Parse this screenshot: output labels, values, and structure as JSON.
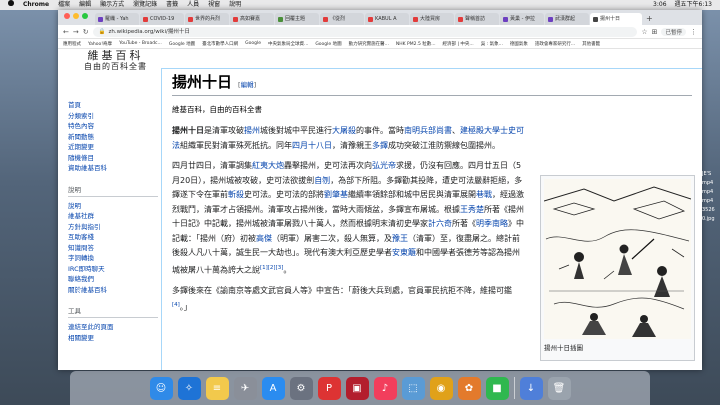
{
  "menubar": {
    "left": [
      "",
      "Chrome",
      "檔案",
      "編輯",
      "顯示方式",
      "瀏覽記錄",
      "書籤",
      "人員",
      "視窗",
      "說明"
    ],
    "right": [
      "3:06",
      "週五下午6:13"
    ]
  },
  "browser": {
    "tabs": [
      {
        "label": "羅織 - Yah",
        "color": "#6d3fc0"
      },
      {
        "label": "COVID-19",
        "color": "#e23b3b"
      },
      {
        "label": "世界的兵烈",
        "color": "#e23b3b"
      },
      {
        "label": "高如賽嘉",
        "color": "#e23b3b"
      },
      {
        "label": "回覆主題",
        "color": "#4a8f3a"
      },
      {
        "label": "《從烈",
        "color": "#e23b3b"
      },
      {
        "label": "KABUL A",
        "color": "#e23b3b"
      },
      {
        "label": "大陸買房",
        "color": "#e23b3b"
      },
      {
        "label": "聲稱首訪",
        "color": "#e23b3b"
      },
      {
        "label": "黃巢 - 伊拉",
        "color": "#6d3fc0"
      },
      {
        "label": "武漢群起",
        "color": "#6d3fc0"
      },
      {
        "label": "揚州十日",
        "color": "#444444",
        "active": true
      }
    ],
    "new_tab": "+",
    "url": "zh.wikipedia.org/wiki/揚州十日",
    "paused_label": "已暫停",
    "bookmarks": [
      "應用程式",
      "Yahoo!奇摩",
      "YouTube - Broadc...",
      "Google 地圖",
      "臺北市數學人口網",
      "Google",
      "中央氣象局全球資...",
      "Google 地圖",
      "動力研究實施在醫...",
      "NHK PM2.5 粒數...",
      "經濟部 | 中央...",
      "吳 : 氣象...",
      "德國氣象",
      "諮政會專家研究行...",
      "其他書籤"
    ]
  },
  "logo": {
    "line1": "維基百科",
    "line2": "自由的百科全書"
  },
  "nav": {
    "main": [
      "首頁",
      "分類索引",
      "特色內容",
      "新聞動態",
      "近期變更",
      "隨機條目",
      "資助維基百科"
    ],
    "help_heading": "說明",
    "help": [
      "說明",
      "維基社群",
      "方針與指引",
      "互助客棧",
      "知識問答",
      "字詞轉換",
      "IRC即時聊天",
      "聯絡我們",
      "關於維基百科"
    ],
    "tools_heading": "工具",
    "tools": [
      "連結至此的頁面",
      "相關變更"
    ]
  },
  "article": {
    "title": "揚州十日",
    "edit_open": "[",
    "edit_label": "編輯",
    "edit_close": "]",
    "subtitle": "維基百科，自由的百科全書",
    "p1": [
      {
        "t": "揚州十日",
        "b": true
      },
      {
        "t": "是清軍攻破"
      },
      {
        "t": "揚州",
        "l": true
      },
      {
        "t": "城後對城中平民進行"
      },
      {
        "t": "大屠殺",
        "l": true
      },
      {
        "t": "的事件。當時"
      },
      {
        "t": "南明兵部尚書",
        "l": true
      },
      {
        "t": "、"
      },
      {
        "t": "建極殿大學士",
        "l": true
      },
      {
        "t": "史可法",
        "l": true
      },
      {
        "t": "組織軍民對清軍殊死抵抗。同年"
      },
      {
        "t": "四月十八日",
        "l": true
      },
      {
        "t": "，清豫親王"
      },
      {
        "t": "多鐸",
        "l": true
      },
      {
        "t": "成功突破江淮防禦線包圍揚州。"
      }
    ],
    "p2": [
      {
        "t": "四月廿四日，清軍調集"
      },
      {
        "t": "紅夷大炮",
        "l": true
      },
      {
        "t": "轟擊揚州，史可法再次向"
      },
      {
        "t": "弘光帝",
        "l": true
      },
      {
        "t": "求援，仍沒有回應。四月廿五日（5月20日），揚州城被攻破，史可法欲拔劍"
      },
      {
        "t": "自刎",
        "l": true
      },
      {
        "t": "，為部下所阻。多鐸勸其投降，遭史可法嚴辭拒絕，多鐸遂下令在軍前"
      },
      {
        "t": "斬殺",
        "l": true
      },
      {
        "t": "史可法。史可法的部將"
      },
      {
        "t": "劉肇基",
        "l": true
      },
      {
        "t": "繼續率領餘部和城中居民與清軍展開"
      },
      {
        "t": "巷戰",
        "l": true
      },
      {
        "t": "，經過激烈戰鬥，清軍才占領揚州。清軍攻占揚州後，當時大雨傾盆，多鐸宣布屠城。根據"
      },
      {
        "t": "王秀楚",
        "l": true
      },
      {
        "t": "所著《揚州十日記》中記載，揚州城被清軍屠戮八十萬人，然而根據明末清初史學家"
      },
      {
        "t": "計六奇",
        "l": true
      },
      {
        "t": "所著《"
      },
      {
        "t": "明季南略",
        "l": true
      },
      {
        "t": "》中記載：「揚州（府）初被"
      },
      {
        "t": "高傑",
        "l": true
      },
      {
        "t": "（明軍）屠害二次，殺人無算，及"
      },
      {
        "t": "豫王",
        "l": true
      },
      {
        "t": "（清軍）至，復盡屠之。總計前後殺人凡八十萬，誠生民一大劫也」。現代有澳大利亞歷史學者"
      },
      {
        "t": "安東籬",
        "l": true
      },
      {
        "t": "和中國學者張德芳等認為揚州城被屠八十萬為誇大之說"
      },
      {
        "t": "[1][2][3]",
        "l": true,
        "sup": true
      },
      {
        "t": "。"
      }
    ],
    "p3": [
      {
        "t": "多鐸後來在《諭南京等處文武官員人等》中宣告：「蔚後大兵到處，官員軍民抗拒不降，維揚可鑑"
      },
      {
        "t": "[4]",
        "l": true,
        "sup": true
      },
      {
        "t": "。」"
      }
    ],
    "image_caption": "揚州十日插圖"
  },
  "dock": [
    {
      "name": "finder",
      "symbol": "☺",
      "color": "#2f8ae8"
    },
    {
      "name": "safari",
      "symbol": "✧",
      "color": "#1e73d6"
    },
    {
      "name": "notes",
      "symbol": "≡",
      "color": "#f2c94c"
    },
    {
      "name": "launchpad",
      "symbol": "✈",
      "color": "#8a8f99"
    },
    {
      "name": "app-store",
      "symbol": "A",
      "color": "#2a8cf0"
    },
    {
      "name": "system-preferences",
      "symbol": "⚙",
      "color": "#6b7280"
    },
    {
      "name": "parallels",
      "symbol": "P",
      "color": "#d33"
    },
    {
      "name": "photo-booth",
      "symbol": "▣",
      "color": "#b31e2d"
    },
    {
      "name": "music",
      "symbol": "♪",
      "color": "#f23e5c"
    },
    {
      "name": "preview",
      "symbol": "⬚",
      "color": "#5a9bd5"
    },
    {
      "name": "chrome",
      "symbol": "◉",
      "color": "#e0a11a"
    },
    {
      "name": "photos",
      "symbol": "✿",
      "color": "#e37a2c"
    },
    {
      "name": "facetime",
      "symbol": "■",
      "color": "#2fb84f"
    },
    {
      "name": "downloads",
      "symbol": "↓",
      "color": "#4f7fd9"
    },
    {
      "name": "trash",
      "symbol": "🗑",
      "color": "#9aa3ad"
    }
  ],
  "desktop_labels": [
    "JE'S",
    "mp4",
    "mp4",
    "mp4",
    "3526",
    "0.jpg"
  ]
}
